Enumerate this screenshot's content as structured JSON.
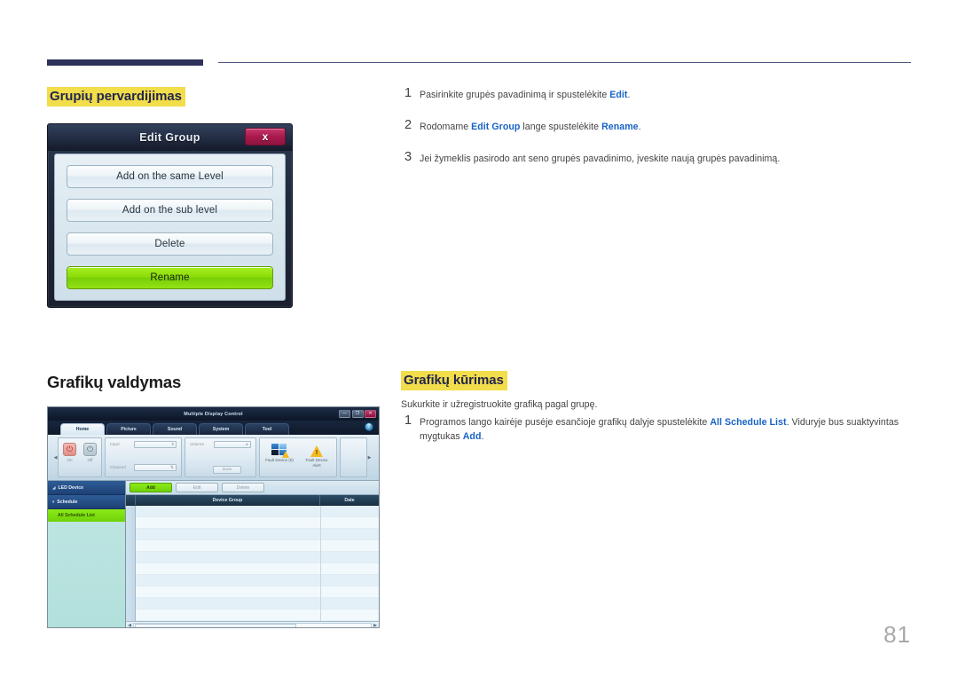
{
  "document": {
    "page_number": "81",
    "language": "lt"
  },
  "sections": [
    {
      "id": "rename_groups",
      "heading": "Grupių pervardijimas",
      "highlighted": true,
      "steps": [
        {
          "num": "1",
          "parts": [
            {
              "t": "Pasirinkite grupės pavadinimą ir spustelėkite ",
              "b": false
            },
            {
              "t": "Edit",
              "b": true
            },
            {
              "t": ".",
              "b": false
            }
          ]
        },
        {
          "num": "2",
          "parts": [
            {
              "t": "Rodomame ",
              "b": false
            },
            {
              "t": "Edit Group",
              "b": true
            },
            {
              "t": " lange spustelėkite ",
              "b": false
            },
            {
              "t": "Rename",
              "b": true
            },
            {
              "t": ".",
              "b": false
            }
          ]
        },
        {
          "num": "3",
          "parts": [
            {
              "t": "Jei žymeklis pasirodo ant seno grupės pavadinimo, įveskite naują grupės pavadinimą.",
              "b": false
            }
          ]
        }
      ]
    },
    {
      "id": "schedule_management",
      "heading": "Grafikų valdymas",
      "highlighted": false
    },
    {
      "id": "schedule_creation",
      "heading": "Grafikų kūrimas",
      "highlighted": true,
      "lead": "Sukurkite ir užregistruokite grafiką pagal grupę.",
      "steps": [
        {
          "num": "1",
          "parts": [
            {
              "t": "Programos lango kairėje pusėje esančioje grafikų dalyje spustelėkite ",
              "b": false
            },
            {
              "t": "All Schedule List",
              "b": true
            },
            {
              "t": ". Viduryje bus suaktyvintas mygtukas ",
              "b": false
            },
            {
              "t": "Add",
              "b": true
            },
            {
              "t": ".",
              "b": false
            }
          ]
        }
      ]
    }
  ],
  "edit_group_dialog": {
    "title": "Edit Group",
    "close_label": "x",
    "buttons": [
      {
        "label": "Add on the same Level",
        "primary": false
      },
      {
        "label": "Add on the sub level",
        "primary": false
      },
      {
        "label": "Delete",
        "primary": false
      },
      {
        "label": "Rename",
        "primary": true
      }
    ],
    "accent_green": "#8ddd0b",
    "close_red": "#a81a4c"
  },
  "mdc_app": {
    "window_title": "Multiple Display Control",
    "window_controls": {
      "minimize": "—",
      "maximize": "❐",
      "close": "✕"
    },
    "help_label": "?",
    "tabs": [
      {
        "label": "Home",
        "active": true
      },
      {
        "label": "Picture",
        "active": false
      },
      {
        "label": "Sound",
        "active": false
      },
      {
        "label": "System",
        "active": false
      },
      {
        "label": "Tool",
        "active": false
      }
    ],
    "ribbon": {
      "power": [
        {
          "label": "On",
          "state": "on"
        },
        {
          "label": "Off",
          "state": "off"
        }
      ],
      "fields": [
        {
          "label": "Input",
          "value": ""
        },
        {
          "label": "Channel",
          "value": ""
        }
      ],
      "volume": {
        "label": "Volume",
        "value": ""
      },
      "mute_label": "Mute",
      "fault_items": [
        {
          "label": "Fault Device (0)",
          "icon": "monitor-warning-icon"
        },
        {
          "label": "Fault Device Alert",
          "icon": "warning-triangle-icon"
        }
      ]
    },
    "sidebar": [
      {
        "label": "LED Device",
        "type": "node",
        "caret": "◢"
      },
      {
        "label": "Schedule",
        "type": "node",
        "caret": "▾"
      },
      {
        "label": "All Schedule List",
        "type": "item",
        "selected": true
      }
    ],
    "toolbar": [
      {
        "label": "Add",
        "enabled": true
      },
      {
        "label": "Edit",
        "enabled": false
      },
      {
        "label": "Delete",
        "enabled": false
      }
    ],
    "table": {
      "columns": [
        "",
        "Device Group",
        "Date"
      ],
      "rows": []
    },
    "accent_green": "#7fdd12",
    "header_navy": "#1d4277"
  }
}
